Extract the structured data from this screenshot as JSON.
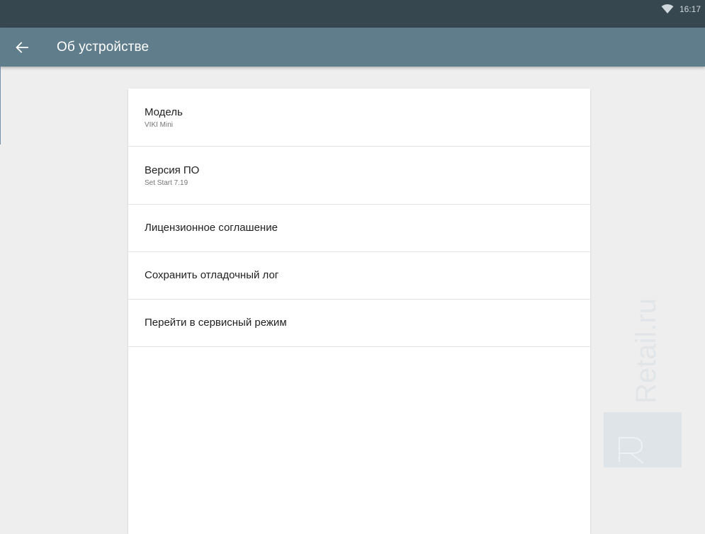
{
  "status_bar": {
    "time": "16:17",
    "wifi_icon": "wifi-icon"
  },
  "app_bar": {
    "back_icon": "arrow-back-icon",
    "title": "Об устройстве"
  },
  "settings": {
    "items": [
      {
        "title": "Модель",
        "subtitle": "VIKI Mini"
      },
      {
        "title": "Версия ПО",
        "subtitle": "Set Start 7.19"
      },
      {
        "title": "Лицензионное соглашение"
      },
      {
        "title": "Сохранить отладочный лог"
      },
      {
        "title": "Перейти в сервисный режим"
      }
    ]
  },
  "watermark": {
    "text": "Retail.ru"
  },
  "colors": {
    "status_bar": "#37474f",
    "app_bar": "#607d8b",
    "background": "#eeeeee",
    "card": "#ffffff"
  }
}
